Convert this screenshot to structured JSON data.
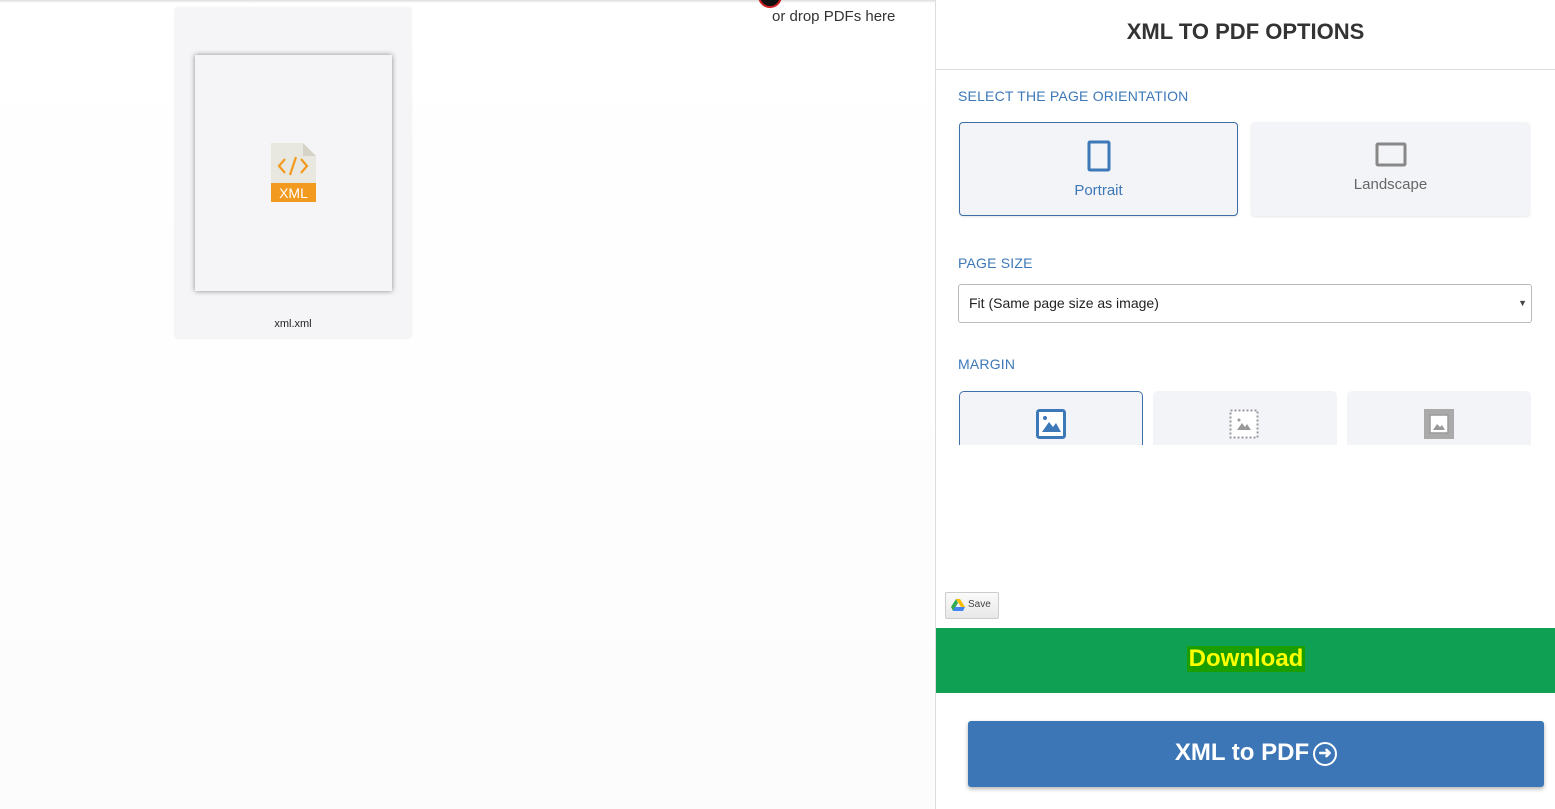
{
  "upload": {
    "drop_text": "or drop PDFs here"
  },
  "file": {
    "name": "xml.xml",
    "badge": "XML",
    "icon": "xml-file-icon"
  },
  "options": {
    "title": "XML TO PDF OPTIONS",
    "orientation": {
      "label": "SELECT THE PAGE ORIENTATION",
      "items": [
        {
          "label": "Portrait",
          "selected": true
        },
        {
          "label": "Landscape",
          "selected": false
        }
      ]
    },
    "page_size": {
      "label": "PAGE SIZE",
      "value": "Fit (Same page size as image)"
    },
    "margin": {
      "label": "MARGIN",
      "selected_index": 0
    }
  },
  "save_label": "Save",
  "download_label": "Download",
  "convert_label": "XML to PDF",
  "colors": {
    "accent": "#3c76b6",
    "download_bg": "#10a054",
    "xml_orange": "#f29a1f"
  }
}
